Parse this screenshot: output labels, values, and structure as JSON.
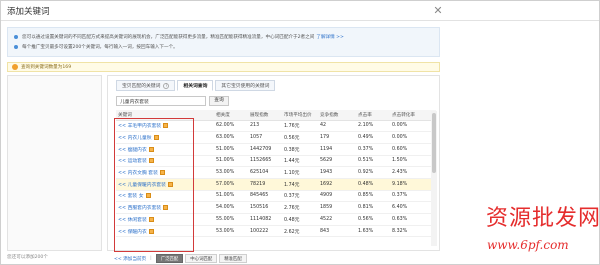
{
  "dialog": {
    "title": "添加关键词"
  },
  "tips": [
    {
      "text": "您可以通过设置关键词的不同匹配方式来提高关键词的展现机会，广泛匹配能获得更多流量，精准匹配能获得精准流量，中心词匹配介于2者之间",
      "link": "了解详情 >>"
    },
    {
      "text": "每个推广宝贝最多可设置200个关键词，每行输入一词，按回车输入下一个。",
      "link": ""
    }
  ],
  "warn": {
    "text": "查询到关键词数量为169"
  },
  "left_footer": "您还可以添加200个",
  "tabs": [
    {
      "label": "宝贝匹配的关键词",
      "active": false,
      "help": "?"
    },
    {
      "label": "相关词查询",
      "active": true
    },
    {
      "label": "其它宝贝使用的关键词",
      "active": false
    }
  ],
  "search": {
    "value": "儿童内衣套装",
    "button": "查询"
  },
  "table": {
    "headers": [
      "关键词",
      "相关度",
      "展现指数",
      "市场平均出价",
      "竞争指数",
      "点击率",
      "点击转化率"
    ],
    "add_prefix": "<<",
    "rows": [
      {
        "kw": "羊毛甲内衣套装",
        "rel": "62.00%",
        "show": "213",
        "bid": "1.76元",
        "comp": "42",
        "ctr": "2.10%",
        "cvr": "0.00%",
        "hl": false
      },
      {
        "kw": "内衣儿童秋",
        "rel": "63.00%",
        "show": "1057",
        "bid": "0.56元",
        "comp": "179",
        "ctr": "0.49%",
        "cvr": "0.00%",
        "hl": false
      },
      {
        "kw": "瘦腿内衣",
        "rel": "51.00%",
        "show": "1442709",
        "bid": "0.38元",
        "comp": "1194",
        "ctr": "0.37%",
        "cvr": "0.60%",
        "hl": false
      },
      {
        "kw": "运动套装",
        "rel": "51.00%",
        "show": "1152665",
        "bid": "1.44元",
        "comp": "5629",
        "ctr": "0.51%",
        "cvr": "1.50%",
        "hl": false
      },
      {
        "kw": "内衣文胸 套装",
        "rel": "53.00%",
        "show": "625104",
        "bid": "1.10元",
        "comp": "1943",
        "ctr": "0.92%",
        "cvr": "2.43%",
        "hl": false
      },
      {
        "kw": "儿童保暖内衣套装",
        "rel": "57.00%",
        "show": "78219",
        "bid": "1.74元",
        "comp": "1692",
        "ctr": "0.48%",
        "cvr": "9.18%",
        "hl": true
      },
      {
        "kw": "套装 女",
        "rel": "51.00%",
        "show": "845465",
        "bid": "0.37元",
        "comp": "4909",
        "ctr": "0.85%",
        "cvr": "0.37%",
        "hl": false
      },
      {
        "kw": "西服套内衣套装",
        "rel": "54.00%",
        "show": "150516",
        "bid": "2.76元",
        "comp": "1859",
        "ctr": "0.81%",
        "cvr": "6.40%",
        "hl": false
      },
      {
        "kw": "休闲套装",
        "rel": "55.00%",
        "show": "1114082",
        "bid": "0.48元",
        "comp": "4522",
        "ctr": "0.56%",
        "cvr": "0.63%",
        "hl": false
      },
      {
        "kw": "保暖内衣",
        "rel": "53.00%",
        "show": "100222",
        "bid": "2.62元",
        "comp": "843",
        "ctr": "1.63%",
        "cvr": "8.32%",
        "hl": false
      }
    ]
  },
  "pager": {
    "add_all": "<< 添加当前页",
    "buttons": [
      {
        "label": "广泛匹配",
        "on": true
      },
      {
        "label": "中心词匹配",
        "on": false
      },
      {
        "label": "精准匹配",
        "on": false
      }
    ]
  },
  "watermark": {
    "line1": "资源批发网",
    "line2": "www.6pf.com"
  },
  "colors": {
    "highlight_box": "#d23a3a",
    "link": "#2a6fc9",
    "row_highlight": "#fff8d9",
    "watermark": "#e52d2d"
  }
}
